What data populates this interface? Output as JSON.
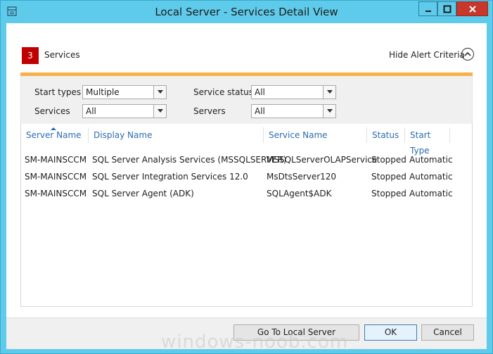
{
  "window": {
    "title": "Local Server - Services Detail View",
    "accent_color": "#5fcbea",
    "close_color": "#c7372b"
  },
  "header": {
    "count": "3",
    "count_label": "Services",
    "hide_criteria_label": "Hide Alert Criteria",
    "badge_color": "#c00000",
    "bar_color": "#f6b14a"
  },
  "criteria": {
    "start_types_label": "Start types",
    "start_types_value": "Multiple",
    "services_label": "Services",
    "services_value": "All",
    "service_status_label": "Service status",
    "service_status_value": "All",
    "servers_label": "Servers",
    "servers_value": "All"
  },
  "table": {
    "columns": [
      "Server Name",
      "Display Name",
      "Service Name",
      "Status",
      "Start Type"
    ],
    "rows": [
      [
        "SM-MAINSCCM",
        "SQL Server Analysis Services (MSSQLSERVER)",
        "MSSQLServerOLAPService",
        "Stopped",
        "Automatic"
      ],
      [
        "SM-MAINSCCM",
        "SQL Server Integration Services 12.0",
        "MsDtsServer120",
        "Stopped",
        "Automatic"
      ],
      [
        "SM-MAINSCCM",
        "SQL Server Agent (ADK)",
        "SQLAgent$ADK",
        "Stopped",
        "Automatic"
      ]
    ]
  },
  "footer": {
    "go_label": "Go To Local Server",
    "ok_label": "OK",
    "cancel_label": "Cancel"
  },
  "watermark": "windows-noob.com"
}
